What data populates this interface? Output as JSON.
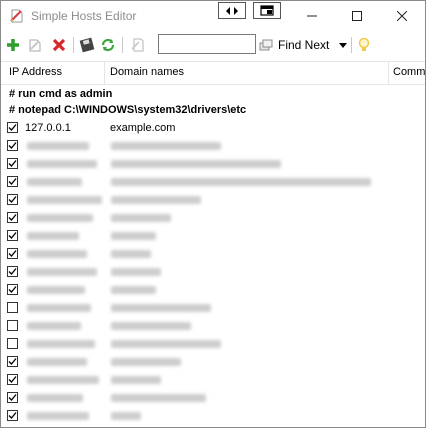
{
  "window": {
    "title": "Simple Hosts Editor"
  },
  "toolbar": {
    "search_value": "",
    "find_next_label": "Find Next",
    "icons": [
      "add-icon",
      "edit-icon",
      "delete-icon",
      "save-icon",
      "refresh-icon",
      "comment-icon",
      "find-icon",
      "dropdown-icon",
      "hint-icon"
    ]
  },
  "columns": [
    "IP Address",
    "Domain names",
    "Comm"
  ],
  "comments": [
    "# run cmd as admin",
    "# notepad C:\\WINDOWS\\system32\\drivers\\etc"
  ],
  "entries": [
    {
      "checked": true,
      "ip": "127.0.0.1",
      "domain": "example.com",
      "redacted": false
    },
    {
      "checked": true,
      "ip": "",
      "domain": "",
      "redacted": true
    },
    {
      "checked": true,
      "ip": "",
      "domain": "",
      "redacted": true
    },
    {
      "checked": true,
      "ip": "",
      "domain": "",
      "redacted": true
    },
    {
      "checked": true,
      "ip": "",
      "domain": "",
      "redacted": true
    },
    {
      "checked": true,
      "ip": "",
      "domain": "",
      "redacted": true
    },
    {
      "checked": true,
      "ip": "",
      "domain": "",
      "redacted": true
    },
    {
      "checked": true,
      "ip": "",
      "domain": "",
      "redacted": true
    },
    {
      "checked": true,
      "ip": "",
      "domain": "",
      "redacted": true
    },
    {
      "checked": true,
      "ip": "",
      "domain": "",
      "redacted": true
    },
    {
      "checked": false,
      "ip": "",
      "domain": "",
      "redacted": true
    },
    {
      "checked": false,
      "ip": "",
      "domain": "",
      "redacted": true
    },
    {
      "checked": false,
      "ip": "",
      "domain": "",
      "redacted": true
    },
    {
      "checked": true,
      "ip": "",
      "domain": "",
      "redacted": true
    },
    {
      "checked": true,
      "ip": "",
      "domain": "",
      "redacted": true
    },
    {
      "checked": true,
      "ip": "",
      "domain": "",
      "redacted": true
    },
    {
      "checked": true,
      "ip": "",
      "domain": "",
      "redacted": true
    },
    {
      "checked": true,
      "ip": "10.0.75.1",
      "domain": "laravel",
      "redacted": false
    }
  ],
  "colors": {
    "add": "#2e9e2e",
    "delete": "#d9262b",
    "refresh": "#3aa63a",
    "hint": "#f2c94c"
  }
}
